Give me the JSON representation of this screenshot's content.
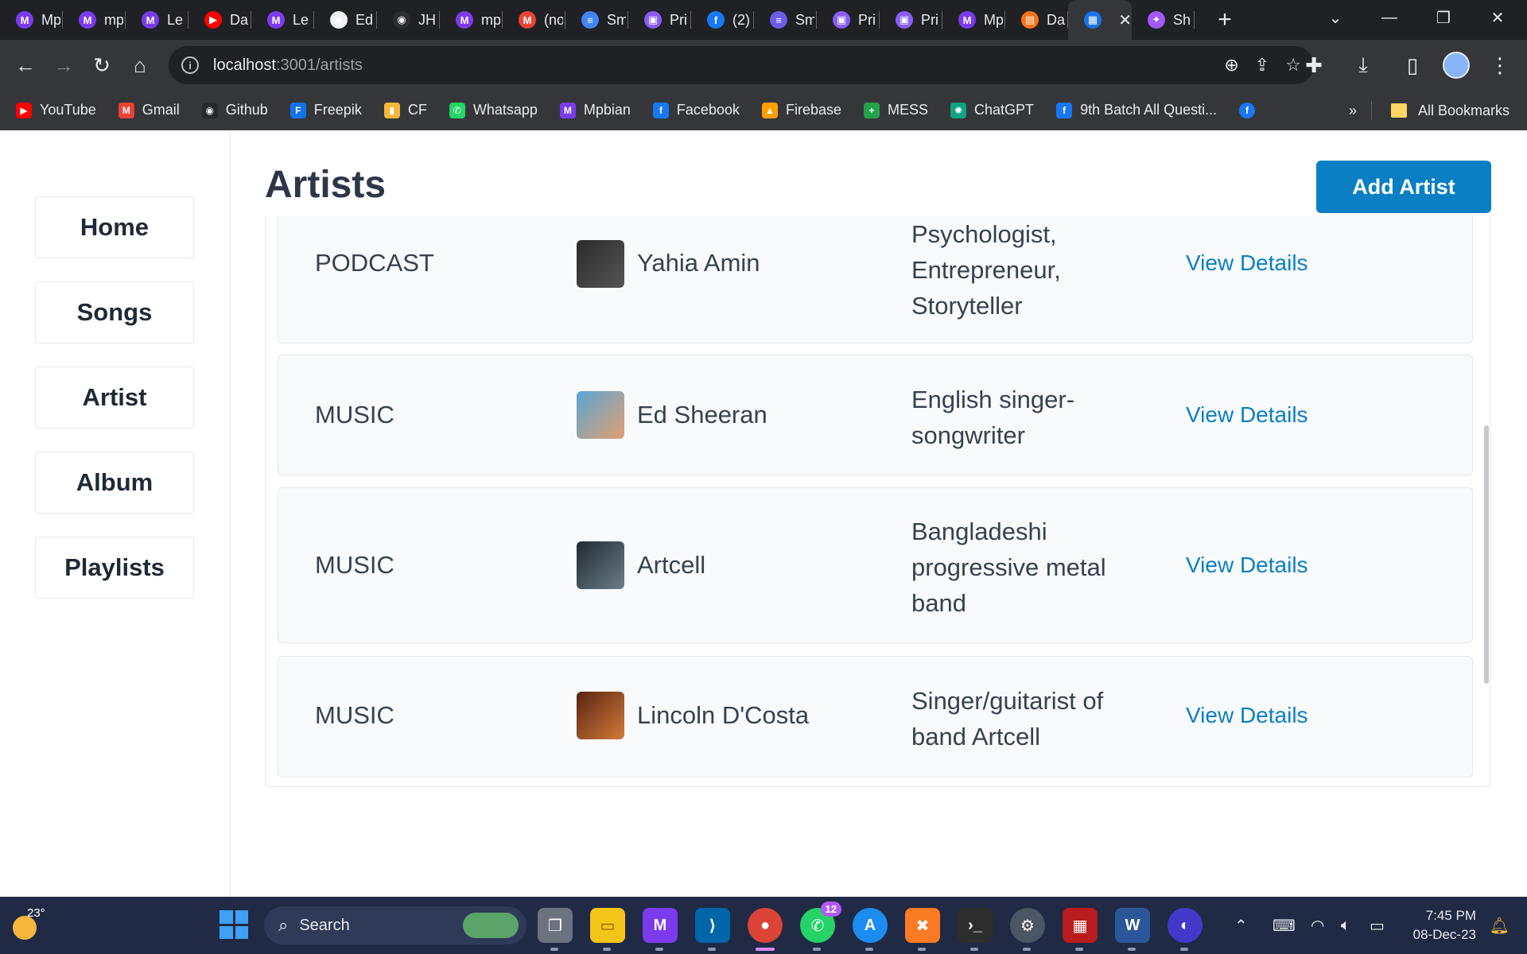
{
  "browser": {
    "tabs": [
      {
        "title": "Mpbian",
        "color": "#7c3aed",
        "glyph": "M"
      },
      {
        "title": "mpbian",
        "color": "#7c3aed",
        "glyph": "M"
      },
      {
        "title": "Le",
        "color": "#7c3aed",
        "glyph": "M"
      },
      {
        "title": "Da",
        "color": "#ff0000",
        "glyph": "▶"
      },
      {
        "title": "Le",
        "color": "#7c3aed",
        "glyph": "M"
      },
      {
        "title": "Ed",
        "color": "#f0f0f0",
        "glyph": "◉"
      },
      {
        "title": "JH",
        "color": "#2d2d2d",
        "glyph": "◉"
      },
      {
        "title": "mp",
        "color": "#7c3aed",
        "glyph": "M"
      },
      {
        "title": "(no",
        "color": "#ea4335",
        "glyph": "M"
      },
      {
        "title": "Sm",
        "color": "#4285f4",
        "glyph": "≡"
      },
      {
        "title": "Pri",
        "color": "#8b5cf6",
        "glyph": "▣"
      },
      {
        "title": "(2)",
        "color": "#1877f2",
        "glyph": "f"
      },
      {
        "title": "Sm",
        "color": "#6d5ce7",
        "glyph": "≡"
      },
      {
        "title": "Pri",
        "color": "#8b5cf6",
        "glyph": "▣"
      },
      {
        "title": "Pri",
        "color": "#8b5cf6",
        "glyph": "▣"
      },
      {
        "title": "Mp",
        "color": "#7c3aed",
        "glyph": "M"
      },
      {
        "title": "Da",
        "color": "#f97316",
        "glyph": "▤"
      }
    ],
    "active_tab": {
      "title": "",
      "color": "#1a73e8",
      "glyph": "▦"
    },
    "last_tab": {
      "title": "Sh",
      "color": "#a259ff",
      "glyph": "✦"
    },
    "url_host": "localhost",
    "url_path": ":3001/artists",
    "bookmarks": [
      {
        "label": "YouTube",
        "color": "#ff0000",
        "glyph": "▶"
      },
      {
        "label": "Gmail",
        "color": "#ea4335",
        "glyph": "M"
      },
      {
        "label": "Github",
        "color": "#24292e",
        "glyph": "◉"
      },
      {
        "label": "Freepik",
        "color": "#1273eb",
        "glyph": "F"
      },
      {
        "label": "CF",
        "color": "#f6b73c",
        "glyph": "▮"
      },
      {
        "label": "Whatsapp",
        "color": "#25d366",
        "glyph": "✆"
      },
      {
        "label": "Mpbian",
        "color": "#7c3aed",
        "glyph": "M"
      },
      {
        "label": "Facebook",
        "color": "#1877f2",
        "glyph": "f"
      },
      {
        "label": "Firebase",
        "color": "#ffa000",
        "glyph": "▲"
      },
      {
        "label": "MESS",
        "color": "#22a34a",
        "glyph": "+"
      },
      {
        "label": "ChatGPT",
        "color": "#10a37f",
        "glyph": "✺"
      },
      {
        "label": "9th Batch All Questi...",
        "color": "#1877f2",
        "glyph": "f"
      }
    ],
    "more_bookmarks": "»",
    "all_bookmarks": "All Bookmarks"
  },
  "sidebar": {
    "items": [
      {
        "label": "Home"
      },
      {
        "label": "Songs"
      },
      {
        "label": "Artist"
      },
      {
        "label": "Album"
      },
      {
        "label": "Playlists"
      }
    ]
  },
  "main": {
    "title": "Artists",
    "add_button": "Add Artist",
    "artists": [
      {
        "type": "PODCAST",
        "name": "Yahia Amin",
        "description": "Psychologist, Entrepreneur, Storyteller",
        "link": "View Details",
        "thumb_colors": [
          "#2b2b2b",
          "#555555"
        ]
      },
      {
        "type": "MUSIC",
        "name": "Ed Sheeran",
        "description": "English singer-songwriter",
        "link": "View Details",
        "thumb_colors": [
          "#5aa6d6",
          "#e0a070"
        ]
      },
      {
        "type": "MUSIC",
        "name": "Artcell",
        "description": "Bangladeshi progressive metal band",
        "link": "View Details",
        "thumb_colors": [
          "#1f2a33",
          "#6b7d88"
        ]
      },
      {
        "type": "MUSIC",
        "name": "Lincoln D'Costa",
        "description": "Singer/guitarist of band Artcell",
        "link": "View Details",
        "thumb_colors": [
          "#5a2410",
          "#d27a3a"
        ]
      }
    ]
  },
  "taskbar": {
    "temperature": "23°",
    "search_placeholder": "Search",
    "whatsapp_badge": "12",
    "time": "7:45 PM",
    "date": "08-Dec-23"
  }
}
